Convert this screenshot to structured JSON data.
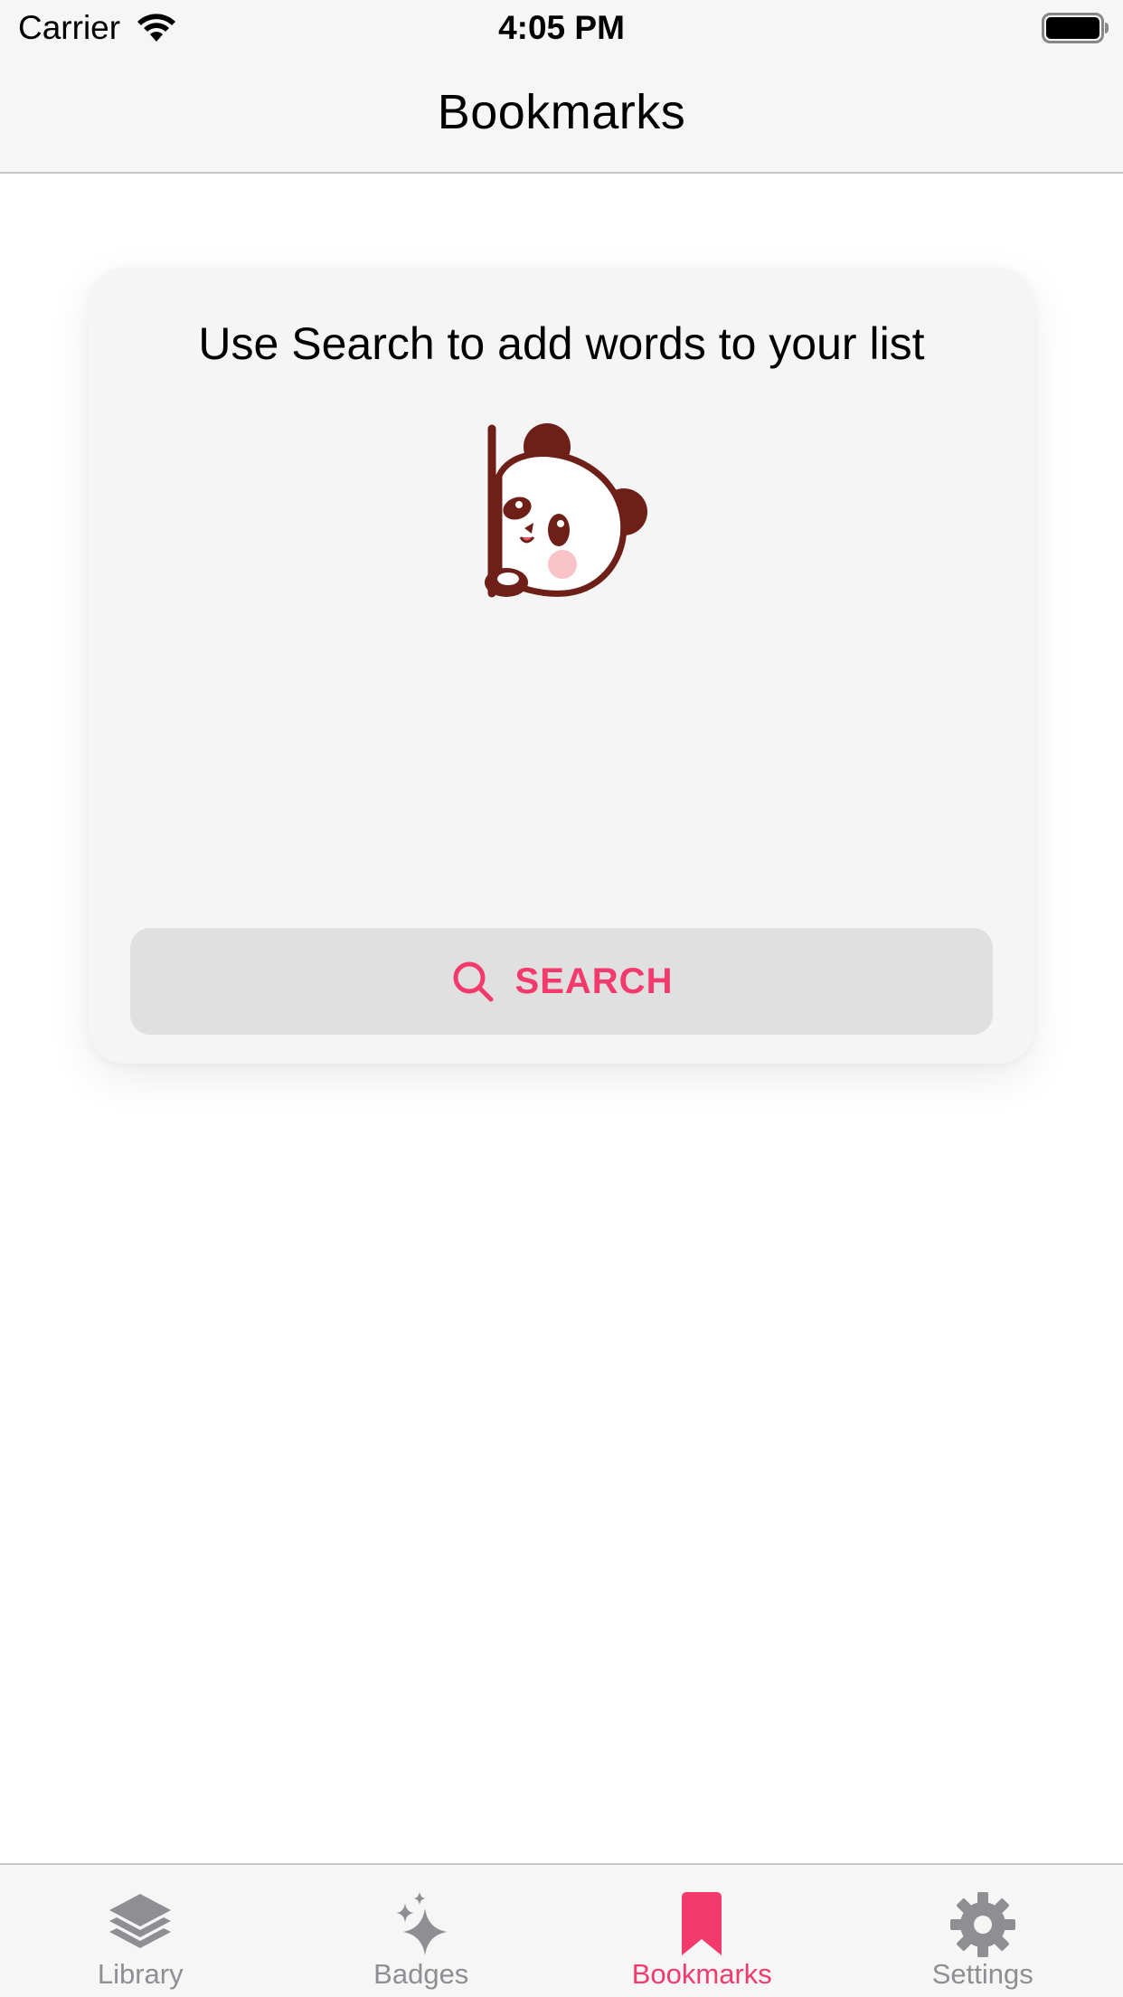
{
  "status_bar": {
    "carrier": "Carrier",
    "time": "4:05 PM",
    "wifi_icon": "wifi-icon",
    "battery_icon": "battery-icon"
  },
  "nav": {
    "title": "Bookmarks"
  },
  "empty_state": {
    "message": "Use Search to add words to your list",
    "illustration": "panda-illustration",
    "search_button": {
      "label": "SEARCH",
      "icon": "search-icon"
    }
  },
  "tab_bar": {
    "tabs": [
      {
        "label": "Library",
        "icon": "layers-icon",
        "active": false
      },
      {
        "label": "Badges",
        "icon": "sparkles-icon",
        "active": false
      },
      {
        "label": "Bookmarks",
        "icon": "bookmark-icon",
        "active": true
      },
      {
        "label": "Settings",
        "icon": "gear-icon",
        "active": false
      }
    ]
  },
  "colors": {
    "accent": "#f23a6c",
    "inactive": "#8e8e93",
    "bar_background": "#f6f6f6",
    "card_background": "#f5f5f5",
    "button_background": "#e0e0e0",
    "panda_outline": "#6e1f18",
    "panda_blush": "#f9c3c8"
  }
}
